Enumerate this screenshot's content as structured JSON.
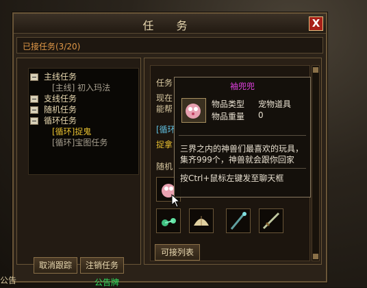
{
  "window": {
    "title": "任 务",
    "close_label": "X"
  },
  "subbar": {
    "accepted_label": "已接任务(3/20)"
  },
  "tree": [
    {
      "type": "cat",
      "label": "主线任务"
    },
    {
      "type": "sub",
      "label": "[主线] 初入玛法"
    },
    {
      "type": "cat",
      "label": "支线任务"
    },
    {
      "type": "cat",
      "label": "随机任务"
    },
    {
      "type": "cat",
      "label": "循环任务"
    },
    {
      "type": "sub",
      "label": "[循环]捉鬼",
      "selected": true
    },
    {
      "type": "sub",
      "label": "[循环]宝图任务"
    }
  ],
  "left_buttons": {
    "untrack": "取消跟踪",
    "abandon": "注销任务"
  },
  "right": {
    "task_label_partial": "任务",
    "line1_partial": "现在",
    "line2_partial": "能帮",
    "obscured_partial": "[循环",
    "catch_partial": "捉拿",
    "random_partial": "随机",
    "accept_list_button": "可接列表"
  },
  "tooltip": {
    "title": "袖兜兜",
    "type_label": "物品类型",
    "type_value": "宠物道具",
    "weight_label": "物品重量",
    "weight_value": "0",
    "description": "三界之内的神兽们最喜欢的玩具，集齐999个，神兽就会跟你回家",
    "hint": "按Ctrl+鼠标左键发至聊天框"
  },
  "bottom": {
    "left_text": "公告",
    "bulletin_label": "公告牌"
  },
  "colors": {
    "accent_orange": "#e09848",
    "selected_yellow": "#e8c030",
    "tooltip_title_magenta": "#e040e0",
    "close_red": "#a82018",
    "bulletin_green": "#30e060"
  }
}
